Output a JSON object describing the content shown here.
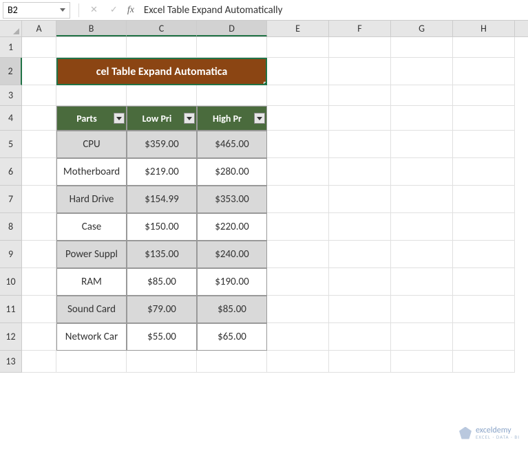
{
  "name_box": "B2",
  "formula_text": "Excel Table Expand Automatically",
  "columns": [
    "A",
    "B",
    "C",
    "D",
    "E",
    "F",
    "G",
    "H"
  ],
  "row_numbers": [
    "1",
    "2",
    "3",
    "4",
    "5",
    "6",
    "7",
    "8",
    "9",
    "10",
    "11",
    "12",
    "13"
  ],
  "merged_title": "cel Table Expand Automatica",
  "table": {
    "headers": [
      "Parts",
      "Low Pri",
      "High Pr"
    ],
    "full_headers": [
      "Parts",
      "Low Price",
      "High Price"
    ],
    "rows": [
      {
        "part": "CPU",
        "low": "$359.00",
        "high": "$465.00",
        "shaded": true
      },
      {
        "part": "Motherboard",
        "low": "$219.00",
        "high": "$280.00",
        "shaded": false
      },
      {
        "part": "Hard Drive",
        "low": "$154.99",
        "high": "$353.00",
        "shaded": true
      },
      {
        "part": "Case",
        "low": "$150.00",
        "high": "$220.00",
        "shaded": false
      },
      {
        "part": "Power Suppl",
        "low": "$135.00",
        "high": "$240.00",
        "shaded": true
      },
      {
        "part": "RAM",
        "low": "$85.00",
        "high": "$190.00",
        "shaded": false
      },
      {
        "part": "Sound Card",
        "low": "$79.00",
        "high": "$85.00",
        "shaded": true
      },
      {
        "part": "Network Car",
        "low": "$55.00",
        "high": "$65.00",
        "shaded": false
      }
    ]
  },
  "watermark": {
    "brand": "exceldemy",
    "tagline": "EXCEL · DATA · BI"
  }
}
